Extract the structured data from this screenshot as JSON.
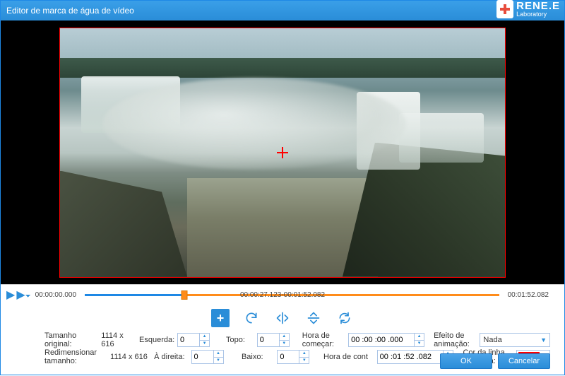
{
  "title": "Editor de marca de água de vídeo",
  "brand": {
    "name": "RENE.E",
    "sub": "Laboratory"
  },
  "timeline": {
    "start": "00:00:00.000",
    "current": "00:00:27.123-00:01:52.082",
    "end": "00:01:52.082"
  },
  "form": {
    "size_orig_label": "Tamanho original:",
    "size_orig_value": "1114 x 616",
    "resize_label": "Redimensionar tamanho:",
    "resize_value": "1114 x 616",
    "left_label": "Esquerda:",
    "left_value": "0",
    "right_label": "À direita:",
    "right_value": "0",
    "top_label": "Topo:",
    "top_value": "0",
    "bottom_label": "Baixo:",
    "bottom_value": "0",
    "start_label": "Hora de começar:",
    "start_value": "00 :00 :00 .000",
    "count_label": "Hora de cont",
    "count_value": "00 :01 :52 .082",
    "effect_label": "Efeito de animação:",
    "effect_value": "Nada",
    "border_label": "Cor da linha de borda:",
    "border_color": "#ff0000"
  },
  "buttons": {
    "ok": "OK",
    "cancel": "Cancelar"
  },
  "icons": {
    "add": "+",
    "caret_up": "▲",
    "caret_down": "▼"
  }
}
